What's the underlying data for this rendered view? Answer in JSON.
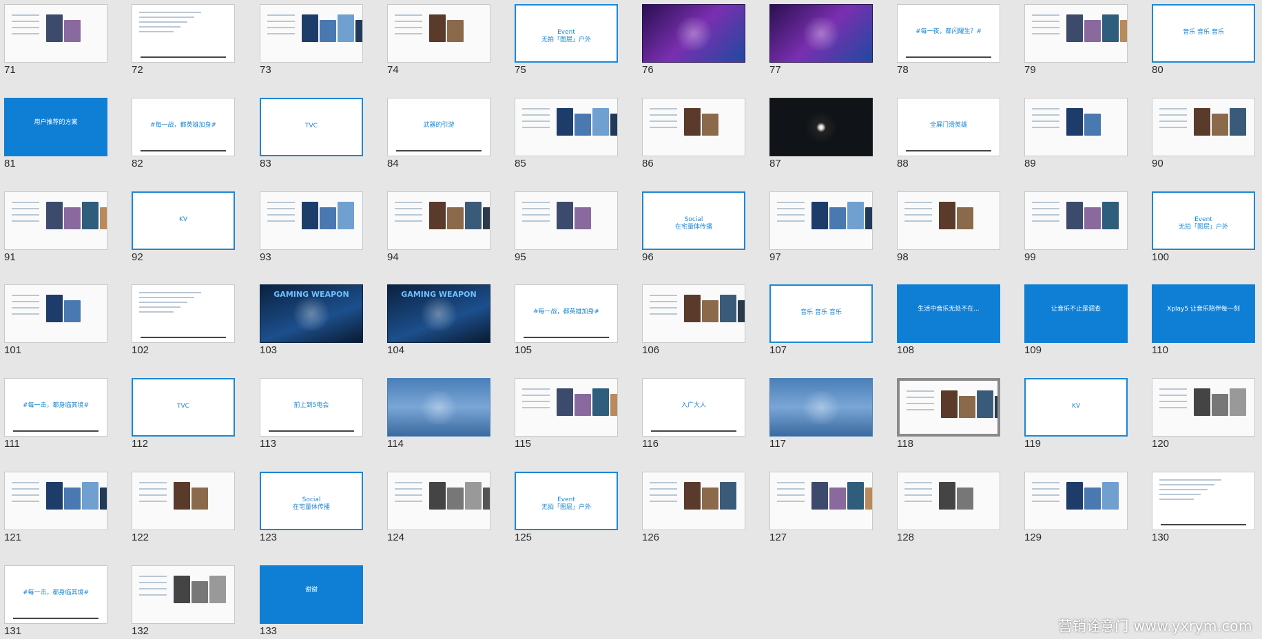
{
  "slides": [
    {
      "num": "71",
      "style": "photos",
      "text": ""
    },
    {
      "num": "72",
      "style": "doc",
      "text": ""
    },
    {
      "num": "73",
      "style": "photos",
      "text": ""
    },
    {
      "num": "74",
      "style": "photos",
      "text": ""
    },
    {
      "num": "75",
      "style": "framed",
      "text": "Event\n无拍「图层」户外"
    },
    {
      "num": "76",
      "style": "purple",
      "text": ""
    },
    {
      "num": "77",
      "style": "purple",
      "text": ""
    },
    {
      "num": "78",
      "style": "doc",
      "text": "#每一夜，都闪耀生？#"
    },
    {
      "num": "79",
      "style": "photos",
      "text": ""
    },
    {
      "num": "80",
      "style": "framed",
      "text": "音乐  音乐  音乐"
    },
    {
      "num": "81",
      "style": "blue",
      "text": "用户推荐的方案"
    },
    {
      "num": "82",
      "style": "doc",
      "text": "#每一战，都英雄加身#"
    },
    {
      "num": "83",
      "style": "framed",
      "text": "TVC"
    },
    {
      "num": "84",
      "style": "doc",
      "text": "武器的引游"
    },
    {
      "num": "85",
      "style": "photos",
      "text": ""
    },
    {
      "num": "86",
      "style": "photos",
      "text": ""
    },
    {
      "num": "87",
      "style": "dark",
      "text": ""
    },
    {
      "num": "88",
      "style": "doc",
      "text": "全屏门滑英雄"
    },
    {
      "num": "89",
      "style": "photos",
      "text": ""
    },
    {
      "num": "90",
      "style": "photos",
      "text": ""
    },
    {
      "num": "91",
      "style": "photos",
      "text": ""
    },
    {
      "num": "92",
      "style": "framed",
      "text": "KV"
    },
    {
      "num": "93",
      "style": "photos",
      "text": ""
    },
    {
      "num": "94",
      "style": "photos",
      "text": ""
    },
    {
      "num": "95",
      "style": "photos",
      "text": ""
    },
    {
      "num": "96",
      "style": "framed",
      "text": "Social\n在宅量体传播"
    },
    {
      "num": "97",
      "style": "photos",
      "text": ""
    },
    {
      "num": "98",
      "style": "photos",
      "text": ""
    },
    {
      "num": "99",
      "style": "photos",
      "text": ""
    },
    {
      "num": "100",
      "style": "framed",
      "text": "Event\n无拍「图层」户外"
    },
    {
      "num": "101",
      "style": "photos",
      "text": ""
    },
    {
      "num": "102",
      "style": "doc",
      "text": ""
    },
    {
      "num": "103",
      "style": "navy",
      "text": "GAMING WEAPON"
    },
    {
      "num": "104",
      "style": "navy",
      "text": "GAMING WEAPON"
    },
    {
      "num": "105",
      "style": "doc",
      "text": "#每一战，都英雄加身#"
    },
    {
      "num": "106",
      "style": "photos",
      "text": ""
    },
    {
      "num": "107",
      "style": "framed",
      "text": "音乐  音乐  音乐"
    },
    {
      "num": "108",
      "style": "blue",
      "text": "生活中音乐无处不在..."
    },
    {
      "num": "109",
      "style": "blue",
      "text": "让音乐不止是调查"
    },
    {
      "num": "110",
      "style": "blue",
      "text": "Xplay5 让音乐陪伴每一刻"
    },
    {
      "num": "111",
      "style": "doc",
      "text": "#每一击，都身临其境#"
    },
    {
      "num": "112",
      "style": "framed",
      "text": "TVC"
    },
    {
      "num": "113",
      "style": "doc",
      "text": "前上到5电会"
    },
    {
      "num": "114",
      "style": "sky",
      "text": ""
    },
    {
      "num": "115",
      "style": "photos",
      "text": ""
    },
    {
      "num": "116",
      "style": "doc",
      "text": "入广大人"
    },
    {
      "num": "117",
      "style": "sky",
      "text": ""
    },
    {
      "num": "118",
      "style": "photos",
      "text": ""
    },
    {
      "num": "119",
      "style": "framed",
      "text": "KV"
    },
    {
      "num": "120",
      "style": "photos",
      "text": ""
    },
    {
      "num": "121",
      "style": "photos",
      "text": ""
    },
    {
      "num": "122",
      "style": "photos",
      "text": ""
    },
    {
      "num": "123",
      "style": "framed",
      "text": "Social\n在宅量体传播"
    },
    {
      "num": "124",
      "style": "photos",
      "text": ""
    },
    {
      "num": "125",
      "style": "framed",
      "text": "Event\n无拍「图层」户外"
    },
    {
      "num": "126",
      "style": "photos",
      "text": ""
    },
    {
      "num": "127",
      "style": "photos",
      "text": ""
    },
    {
      "num": "128",
      "style": "photos",
      "text": ""
    },
    {
      "num": "129",
      "style": "photos",
      "text": ""
    },
    {
      "num": "130",
      "style": "doc",
      "text": ""
    },
    {
      "num": "131",
      "style": "doc",
      "text": "#每一击，都身临其境#"
    },
    {
      "num": "132",
      "style": "photos",
      "text": ""
    },
    {
      "num": "133",
      "style": "blue",
      "text": "谢谢"
    }
  ],
  "selected_slide": "118",
  "watermark": "营销诠意门 www.yxrym.com"
}
